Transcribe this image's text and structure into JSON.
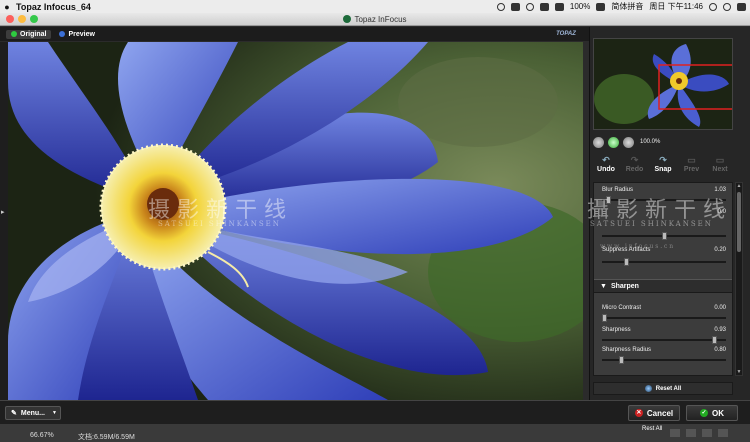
{
  "menubar": {
    "app_name": "Topaz Infocus_64",
    "battery": "100%",
    "input_method": "简体拼音",
    "clock": "周日 下午11:46"
  },
  "window": {
    "title": "Topaz InFocus"
  },
  "tabs": [
    {
      "label": "Original",
      "color": "#2ecc40"
    },
    {
      "label": "Preview",
      "color": "#3b6fd6"
    }
  ],
  "brand": "TOPAZ",
  "watermark": {
    "left_main": "摄 影 新 干 线",
    "left_sub": "SATSUEI SHINKANSEN",
    "right_main": "攝 影 新 干 线",
    "right_sub": "SATSUEI SHINKANSEN",
    "url": "w w w . i n f o c u s . c n"
  },
  "zoom": {
    "percent": "100.0%"
  },
  "actions": [
    {
      "label": "Undo",
      "icon": "undo-icon",
      "enabled": true
    },
    {
      "label": "Redo",
      "icon": "redo-icon",
      "enabled": false
    },
    {
      "label": "Snap",
      "icon": "snap-icon",
      "enabled": true
    },
    {
      "label": "Prev",
      "icon": "prev-icon",
      "enabled": false
    },
    {
      "label": "Next",
      "icon": "next-icon",
      "enabled": false
    }
  ],
  "settings": {
    "blur_radius": {
      "label": "Blur Radius",
      "value": "1.03",
      "level": 0.05
    },
    "row2": {
      "label": "",
      "value": "0.0",
      "level": 0.5
    },
    "suppress_artifacts": {
      "label": "Suppress Artifacts",
      "value": "0.20",
      "level": 0.2
    },
    "sharpen_section": "Sharpen",
    "micro_contrast": {
      "label": "Micro Contrast",
      "value": "0.00",
      "level": 0.0
    },
    "sharpness": {
      "label": "Sharpness",
      "value": "0.93",
      "level": 0.93
    },
    "sharpness_radius": {
      "label": "Sharpness Radius",
      "value": "0.80",
      "level": 0.16
    }
  },
  "reset_all": "Reset All",
  "bottom": {
    "menu": "Menu...",
    "cancel": "Cancel",
    "ok": "OK"
  },
  "status": {
    "zoom": "66.67%",
    "doc": "文档:6.59M/6.59M",
    "reset": "Rest All"
  }
}
